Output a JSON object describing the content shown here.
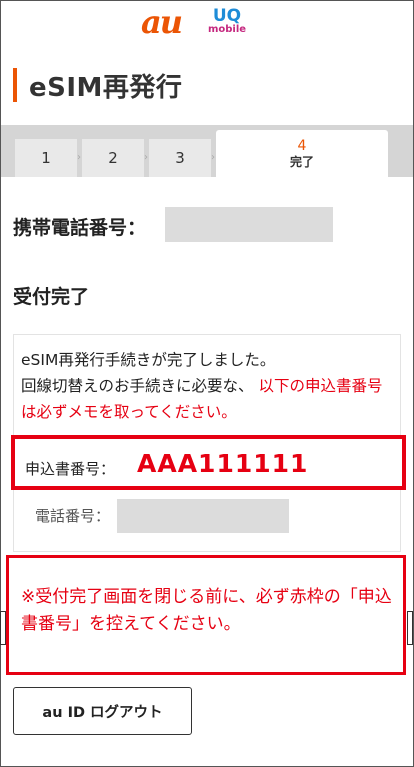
{
  "header": {
    "au_logo": "au",
    "uq_logo_top": "UQ",
    "uq_logo_bottom": "mobile"
  },
  "page_title": "eSIM再発行",
  "steps": [
    {
      "num": "1"
    },
    {
      "num": "2"
    },
    {
      "num": "3"
    },
    {
      "num": "4",
      "label": "完了"
    }
  ],
  "phone_number_label": "携帯電話番号：",
  "section_heading": "受付完了",
  "message": {
    "line1": "eSIM再発行手続きが完了しました。",
    "line2_black": "回線切替えのお手続きに必要な、",
    "line2_red": "以下の申込書番号は必ずメモを取ってください。"
  },
  "application_number": {
    "label": "申込書番号：",
    "value": "AAA111111"
  },
  "telephone_label": "電話番号：",
  "warning_text": "※受付完了画面を閉じる前に、必ず赤枠の「申込書番号」を控えてください。",
  "logout_button": "au ID ログアウト",
  "colors": {
    "au_orange": "#eb5505",
    "alert_red": "#e60012",
    "uq_blue": "#1e8cd7",
    "uq_magenta": "#c5287f"
  }
}
